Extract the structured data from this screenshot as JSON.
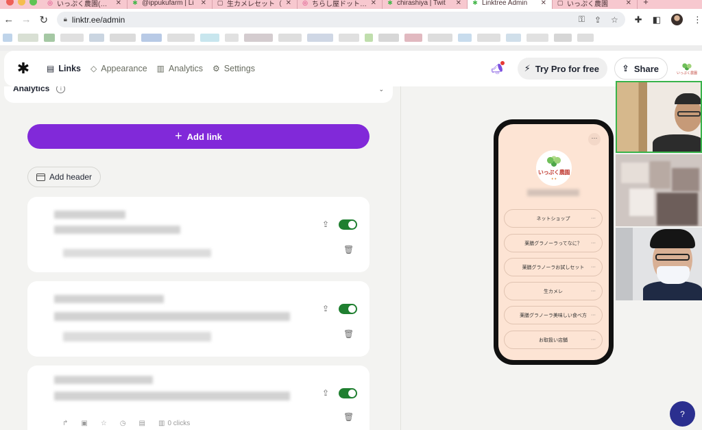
{
  "browser": {
    "tabs": [
      {
        "title": "いっぷく農園(@ip",
        "icon": "instagram-icon",
        "color": "#d9317a"
      },
      {
        "title": "@ippukufarm | Li",
        "icon": "linktree-icon",
        "color": "#43b649"
      },
      {
        "title": "生カメレセット（",
        "icon": "document-icon",
        "color": "#444444"
      },
      {
        "title": "ちらし屋ドットコム",
        "icon": "instagram-icon",
        "color": "#d9317a"
      },
      {
        "title": "chirashiya | Twit",
        "icon": "linktree-icon",
        "color": "#43b649"
      },
      {
        "title": "Linktree Admin",
        "icon": "linktree-icon",
        "color": "#43b649",
        "active": true
      },
      {
        "title": "いっぷく農園",
        "icon": "document-icon",
        "color": "#444444"
      }
    ],
    "new_tab": "+",
    "url": "linktr.ee/admin"
  },
  "header": {
    "logo": "✱",
    "nav": [
      {
        "label": "Links",
        "icon": "links-icon",
        "active": true
      },
      {
        "label": "Appearance",
        "icon": "appearance-icon",
        "active": false
      },
      {
        "label": "Analytics",
        "icon": "analytics-icon",
        "active": false
      },
      {
        "label": "Settings",
        "icon": "settings-icon",
        "active": false
      }
    ],
    "try_pro": "Try Pro for free",
    "share": "Share",
    "profile_text": "いっぷく農園"
  },
  "editor": {
    "analytics_label": "Analytics",
    "add_link": "Add link",
    "add_header": "Add header",
    "card_clicks": "0 clicks"
  },
  "preview": {
    "farm_name": "いっぷく農園",
    "buttons": [
      "ネットショップ",
      "薬膳グラノーラってなに？",
      "薬膳グラノーラお試しセット",
      "生カメレ",
      "薬膳グラノーラ美味しい食べ方",
      "お取扱い店舗"
    ]
  },
  "help": "?",
  "colors": {
    "accent_purple": "#8129d9",
    "toggle_green": "#1f7f30",
    "preview_bg": "#fde4d4",
    "help_button": "#2b2f8f"
  }
}
